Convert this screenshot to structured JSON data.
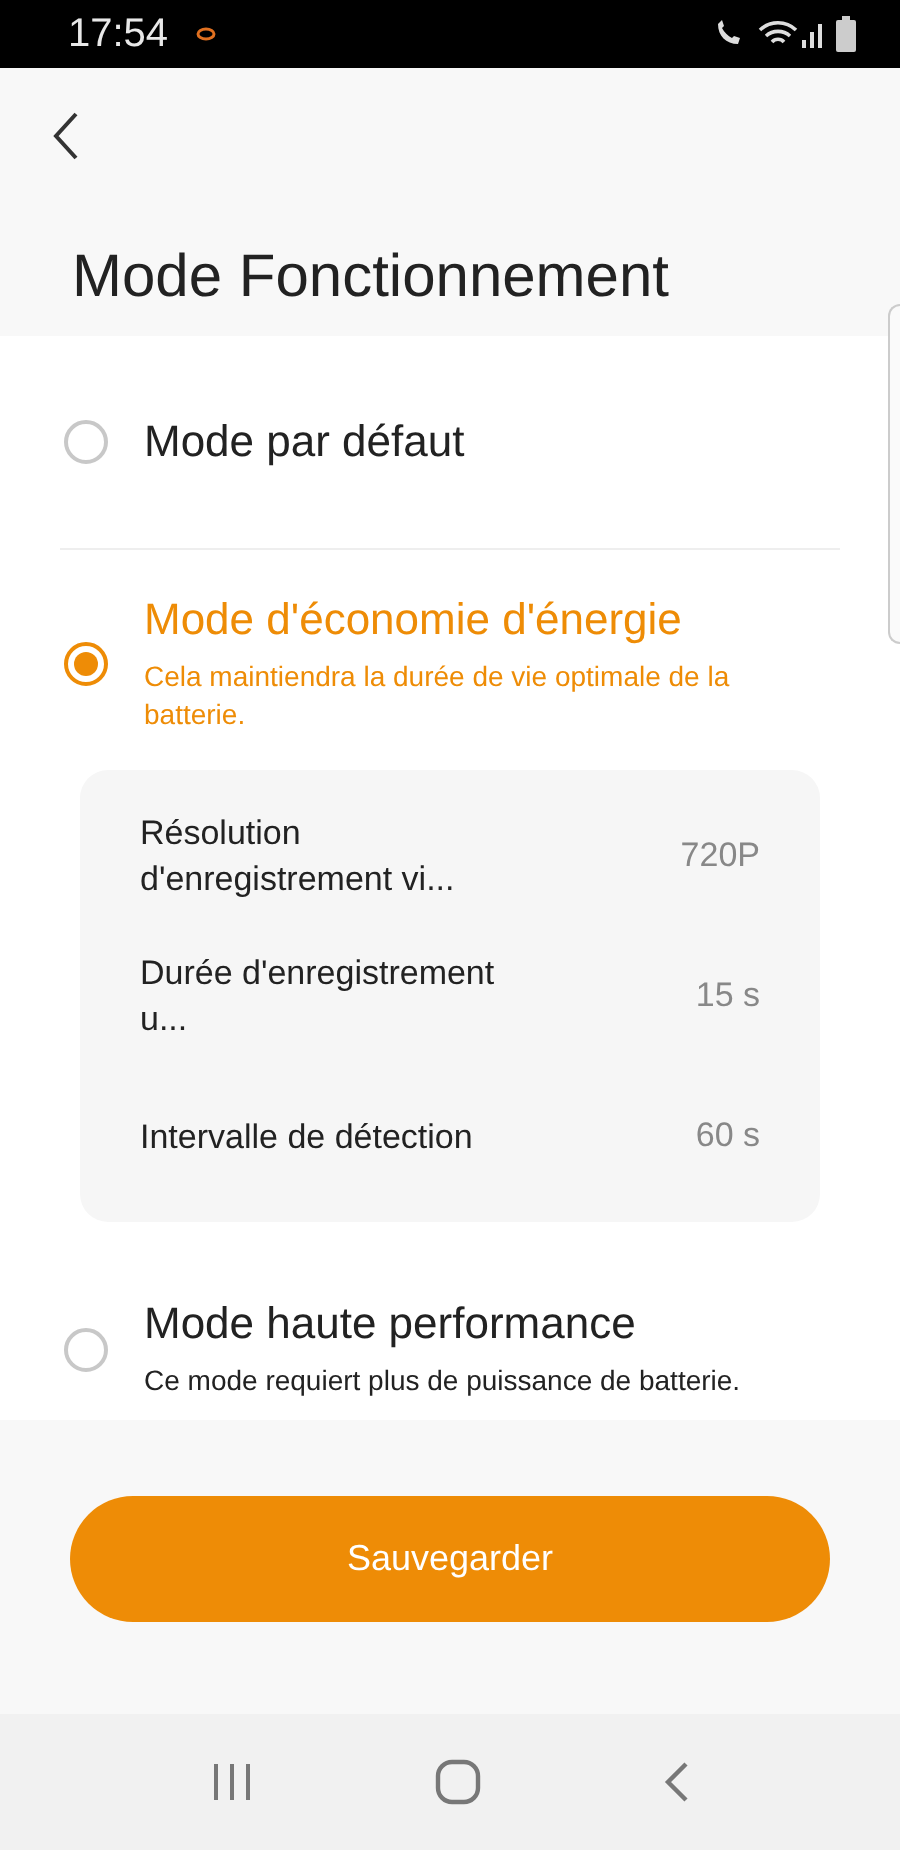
{
  "status_bar": {
    "time": "17:54"
  },
  "header": {
    "title": "Mode Fonctionnement"
  },
  "modes": [
    {
      "title": "Mode par défaut",
      "selected": false
    },
    {
      "title": "Mode d'économie d'énergie",
      "selected": true,
      "description": "Cela maintiendra la durée de vie optimale de la batterie.",
      "settings": [
        {
          "label": "Résolution d'enregistrement vi...",
          "value": "720P"
        },
        {
          "label": "Durée d'enregistrement u...",
          "value": "15 s"
        },
        {
          "label": "Intervalle de détection",
          "value": "60 s"
        }
      ]
    },
    {
      "title": "Mode haute performance",
      "selected": false,
      "description": "Ce mode requiert plus de puissance de batterie."
    }
  ],
  "save_button": {
    "label": "Sauvegarder"
  }
}
